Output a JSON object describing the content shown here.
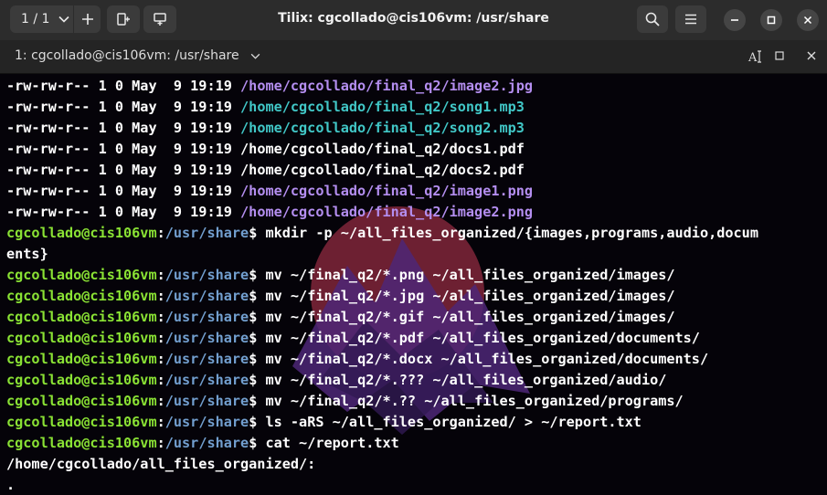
{
  "window": {
    "title": "Tilix: cgcollado@cis106vm: /usr/share",
    "session_counter": "1 / 1"
  },
  "tab": {
    "title": "1: cgcollado@cis106vm: /usr/share"
  },
  "icons": [
    "chevron-down-icon",
    "plus-icon",
    "split-right-icon",
    "split-down-icon",
    "search-icon",
    "menu-icon",
    "minimize-icon",
    "maximize-icon",
    "close-icon",
    "text-cursor-icon",
    "restore-icon",
    "close-tab-icon"
  ],
  "colors": {
    "prompt_user": "#8ae234",
    "prompt_path": "#729fcf",
    "image_file": "#b48ef0",
    "audio_file": "#41c7c7",
    "text": "#ffffff",
    "background": "#050309"
  },
  "prompt": {
    "user": "cgcollado@cis106vm",
    "path": "/usr/share",
    "symbol": "$ "
  },
  "listing": [
    {
      "meta": "-rw-rw-r-- 1 0 May  9 19:19 ",
      "file": "/home/cgcollado/final_q2/image2.jpg",
      "kind": "image"
    },
    {
      "meta": "-rw-rw-r-- 1 0 May  9 19:19 ",
      "file": "/home/cgcollado/final_q2/song1.mp3",
      "kind": "audio"
    },
    {
      "meta": "-rw-rw-r-- 1 0 May  9 19:19 ",
      "file": "/home/cgcollado/final_q2/song2.mp3",
      "kind": "audio"
    },
    {
      "meta": "-rw-rw-r-- 1 0 May  9 19:19 ",
      "file": "/home/cgcollado/final_q2/docs1.pdf",
      "kind": "plain"
    },
    {
      "meta": "-rw-rw-r-- 1 0 May  9 19:19 ",
      "file": "/home/cgcollado/final_q2/docs2.pdf",
      "kind": "plain"
    },
    {
      "meta": "-rw-rw-r-- 1 0 May  9 19:19 ",
      "file": "/home/cgcollado/final_q2/image1.png",
      "kind": "image"
    },
    {
      "meta": "-rw-rw-r-- 1 0 May  9 19:19 ",
      "file": "/home/cgcollado/final_q2/image2.png",
      "kind": "image"
    }
  ],
  "mkdir_command": "mkdir -p ~/all_files_organized/{images,programs,audio,docum",
  "mkdir_wrap": "ents}",
  "commands": [
    "mv ~/final_q2/*.png ~/all_files_organized/images/",
    "mv ~/final_q2/*.jpg ~/all_files_organized/images/",
    "mv ~/final_q2/*.gif ~/all_files_organized/images/",
    "mv ~/final_q2/*.pdf ~/all_files_organized/documents/",
    "mv ~/final_q2/*.docx ~/all_files_organized/documents/",
    "mv ~/final_q2/*.??? ~/all_files_organized/audio/",
    "mv ~/final_q2/*.?? ~/all_files_organized/programs/",
    "ls -aRS ~/all_files_organized/ > ~/report.txt",
    "cat ~/report.txt"
  ],
  "output": [
    "/home/cgcollado/all_files_organized/:",
    "."
  ]
}
